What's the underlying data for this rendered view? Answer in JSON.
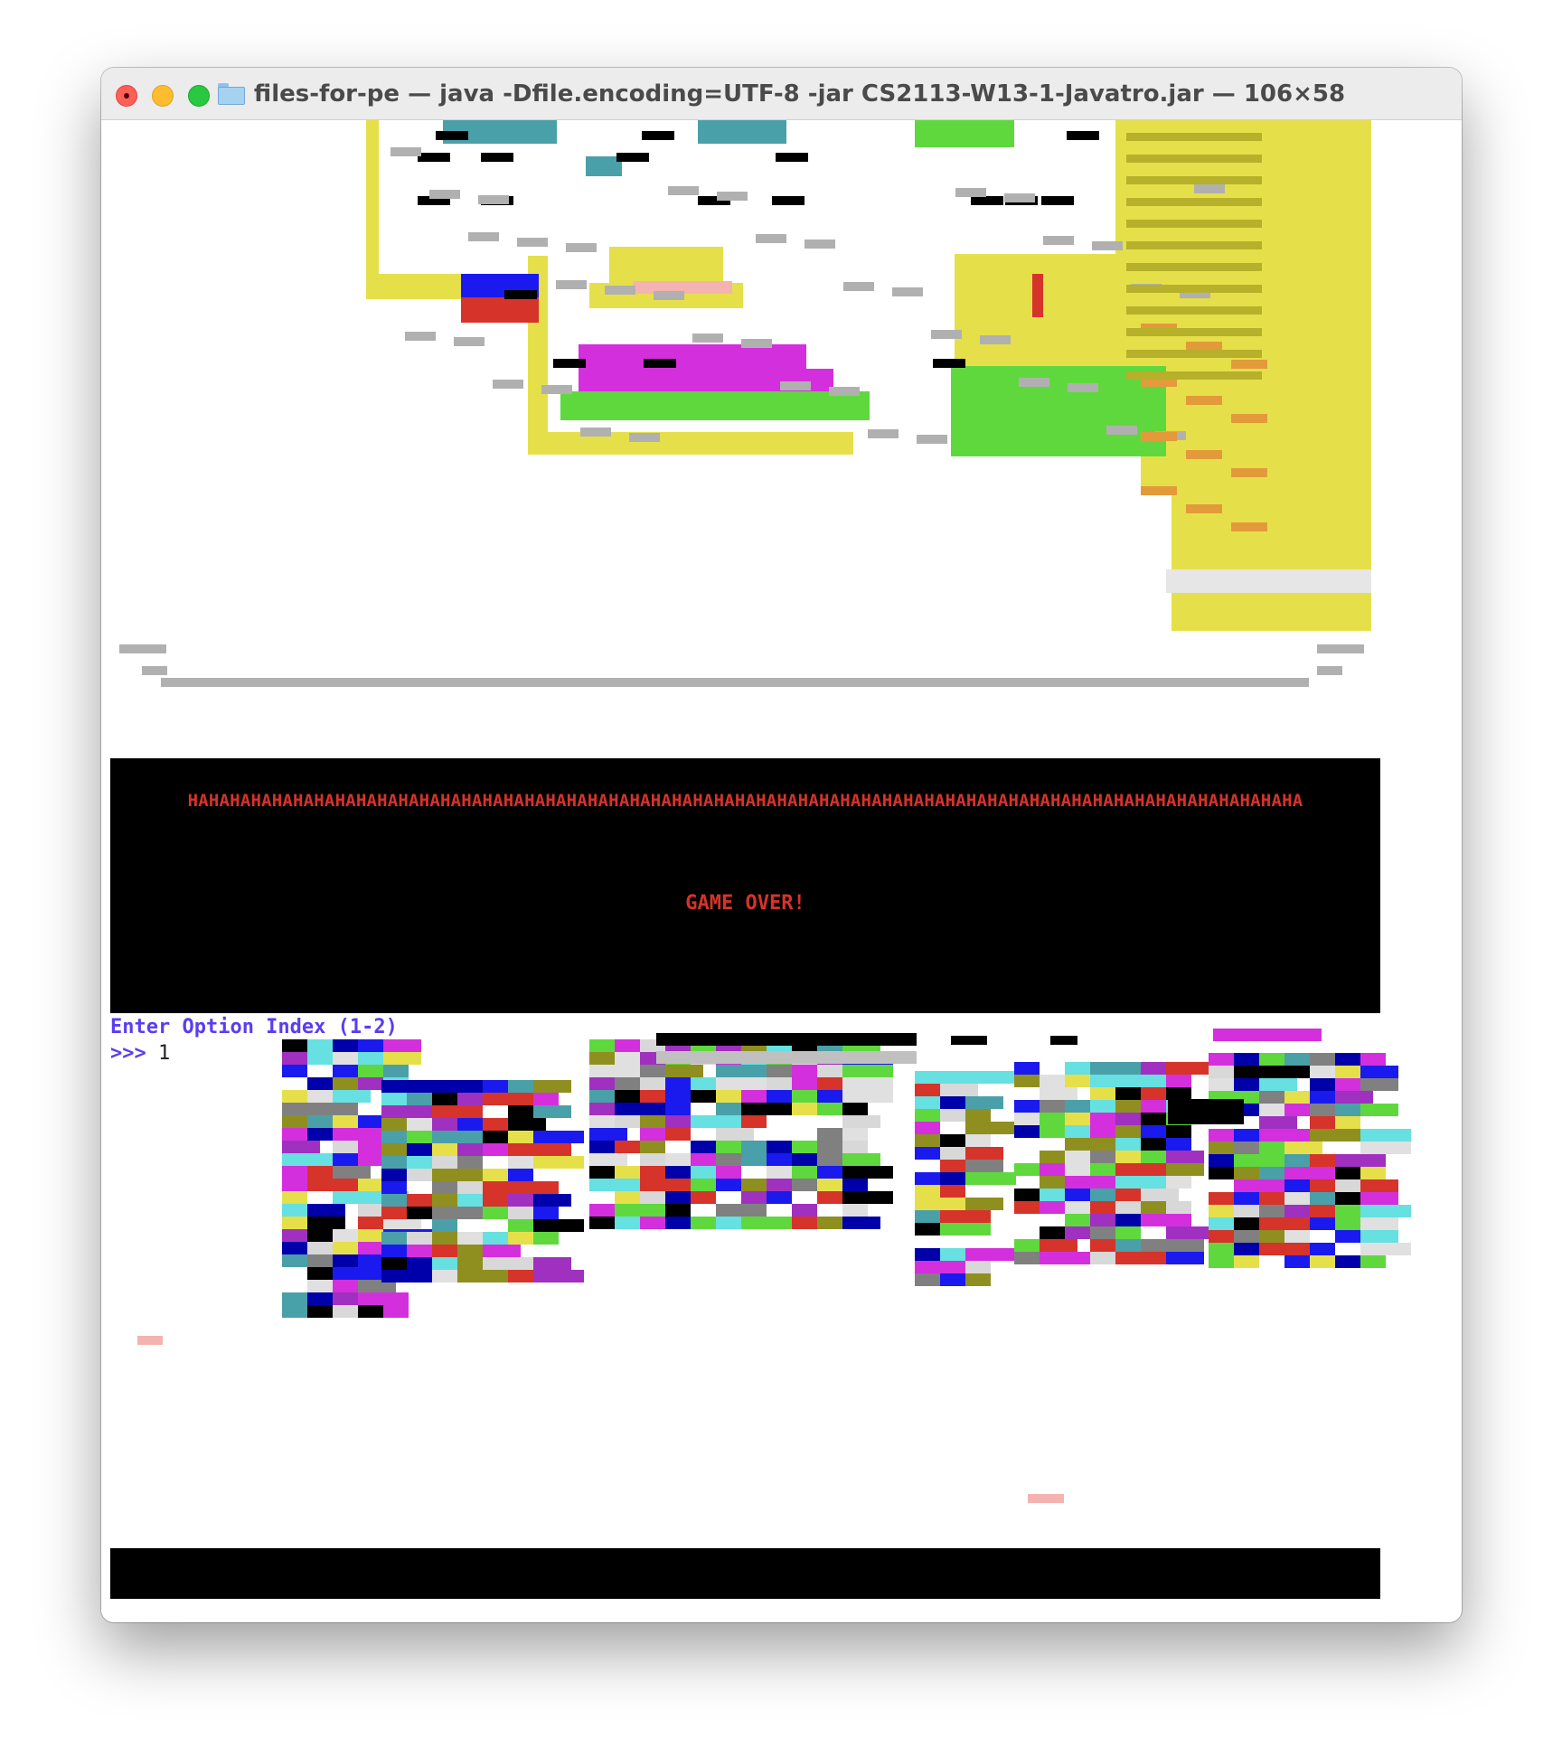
{
  "window": {
    "title": "files-for-pe — java -Dfile.encoding=UTF-8 -jar CS2113-W13-1-Javatro.jar — 106×58",
    "folder_icon": "folder-icon"
  },
  "terminal": {
    "laugh_text": "HAHAHAHAHAHAHAHAHAHAHAHAHAHAHAHAHAHAHAHAHAHAHAHAHAHAHAHAHAHAHAHAHAHAHAHAHAHAHAHAHAHAHAHAHAHAHAHAHAHAHAHAHA",
    "game_over_text": "GAME OVER!",
    "prompt_label": "Enter Option Index (1-2)",
    "input_prefix": ">>> ",
    "input_value": "1"
  },
  "colors": {
    "prompt": "#5b3df0",
    "game_over": "#d6332a",
    "panel_bg": "#000000",
    "art_yellow": "#e5e04a",
    "art_magenta": "#d42fdc",
    "art_green": "#5fd83e",
    "art_teal": "#4aa0a8",
    "art_red": "#d6332a",
    "art_blue": "#1a1aee"
  }
}
